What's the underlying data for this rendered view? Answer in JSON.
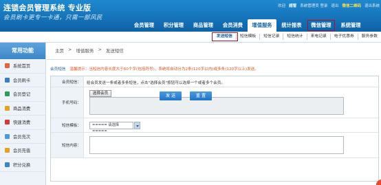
{
  "app": {
    "title": "连锁会员管理系统 专业版",
    "slogan": "会员刷卡更专一卡通，只需一部风民"
  },
  "toplinks": [
    {
      "label": "欢迎",
      "style": "normal"
    },
    {
      "label": "超管",
      "style": "strong"
    },
    {
      "label": "系统管理员 登录",
      "style": "normal"
    },
    {
      "label": "退出",
      "style": "normal"
    },
    {
      "label": "微信二维码",
      "style": "yellow"
    },
    {
      "label": "退出系统",
      "style": "normal"
    }
  ],
  "mainnav": [
    {
      "label": "会员管理",
      "state": "normal"
    },
    {
      "label": "积分管理",
      "state": "normal"
    },
    {
      "label": "商品管理",
      "state": "normal"
    },
    {
      "label": "会员消费",
      "state": "normal"
    },
    {
      "label": "增值服务",
      "state": "active"
    },
    {
      "label": "统计报表",
      "state": "normal"
    },
    {
      "label": "微信管理",
      "state": "boxed"
    },
    {
      "label": "系统管理",
      "state": "normal"
    }
  ],
  "subnav": [
    {
      "label": "发送短信",
      "active": true
    },
    {
      "label": "短信模板",
      "active": false
    },
    {
      "label": "短信记录",
      "active": false
    },
    {
      "label": "短信统计",
      "active": false
    },
    {
      "label": "来电记录",
      "active": false
    },
    {
      "label": "电子优惠券",
      "active": false
    },
    {
      "label": "服务参数",
      "active": false
    }
  ],
  "sidebar": {
    "header": "常用功能",
    "items": [
      {
        "label": "系统首页",
        "icon": "home-icon",
        "color": "#e2643a"
      },
      {
        "label": "会员刷卡",
        "icon": "user-card-icon",
        "color": "#3b7cc6"
      },
      {
        "label": "会员登记",
        "icon": "user-add-icon",
        "color": "#2f9d5a"
      },
      {
        "label": "商品消费",
        "icon": "cart-icon",
        "color": "#e8a11f"
      },
      {
        "label": "快速消费",
        "icon": "lightning-icon",
        "color": "#d33c3c"
      },
      {
        "label": "会员充次",
        "icon": "recharge-count-icon",
        "color": "#4b9bd8"
      },
      {
        "label": "会员充值",
        "icon": "wallet-icon",
        "color": "#e5a21d"
      },
      {
        "label": "积分兑换",
        "icon": "gift-icon",
        "color": "#3c84c9"
      }
    ]
  },
  "breadcrumb": [
    "主页",
    ">",
    "增值服务",
    ">",
    "发送短信"
  ],
  "notice": {
    "tag": "会员短信",
    "warning": "温馨提示：当短信内容长度大于60个字(包括符号)，系统将自动分为2条(120字以内)或多条(120字以上)发送。"
  },
  "form": {
    "member_label": "会员短信：",
    "member_hint": "给会员发送一条或者多条短信，点击\"选择会员\"按钮可以选择一个或者多个会员。",
    "phone_label": "手机号码：",
    "select_member_btn": "选择会员",
    "template_label": "短信模板：",
    "template_value": "===== 请选择 =====",
    "content_label": "短信内容：",
    "send_btn": "发 送",
    "reset_btn": "重 置"
  }
}
